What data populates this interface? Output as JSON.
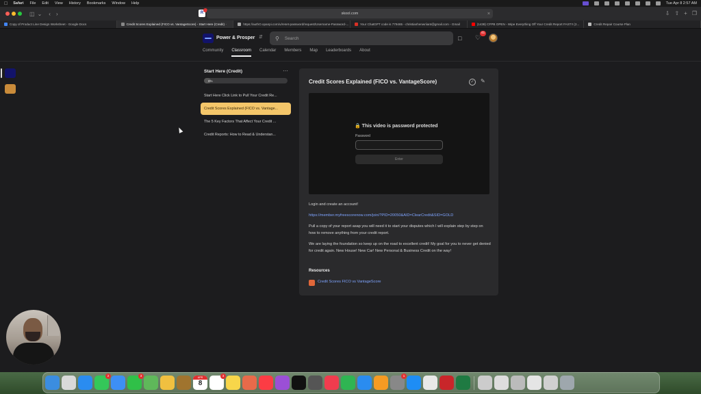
{
  "menubar": {
    "app": "Safari",
    "items": [
      "File",
      "Edit",
      "View",
      "History",
      "Bookmarks",
      "Window",
      "Help"
    ],
    "clock": "Tue Apr 8  2:57 AM"
  },
  "browser": {
    "url": "skool.com",
    "extension_badge": "R"
  },
  "tabs": [
    {
      "label": "Copy of Product Line Design Worksheet - Google Docs",
      "color": "#4285f4"
    },
    {
      "label": "Credit Scores Explained (FICO vs. VantageScore) - Start Here (Credit) ·",
      "color": "#888888",
      "active": true
    },
    {
      "label": "https://authO.opanpi.com/u/reset-password/request/Username-Password-...",
      "color": "#aaaaaa"
    },
    {
      "label": "Your ChatGPT code is 779465 - christianhenwriiant@gmail.com - Gmail",
      "color": "#d93025"
    },
    {
      "label": "(1438) CFPB OPEN - Wipe Everything Off Your Credit Report FAST!! (2...",
      "color": "#ff0000"
    },
    {
      "label": "Credit Repair Course Plan",
      "color": "#bbbbbb"
    }
  ],
  "header": {
    "brand": "Power & Prosper",
    "search_placeholder": "Search",
    "notifications": "41"
  },
  "nav": [
    "Community",
    "Classroom",
    "Calendar",
    "Members",
    "Map",
    "Leaderboards",
    "About"
  ],
  "course": {
    "title": "Start Here (Credit)",
    "progress_label": "8%",
    "progress": 0.08,
    "lessons": [
      "Start Here Click Link to Pull Your Credit Re...",
      "Credit Scores Explained (FICO vs. Vantage...",
      "The 5 Key Factors That Affect Your Credit ...",
      "Credit Reports: How to Read & Understan..."
    ]
  },
  "lesson": {
    "title": "Credit Scores Explained (FICO vs. VantageScore)",
    "video_message": "This video is password protected",
    "password_label": "Password",
    "enter_label": "Enter",
    "p1": "Login and create an account!",
    "link": "https://member.myfreescorenow.com/join/?PID=20050&AID=ClearCredit&SID=GOLD",
    "p2": "Pull a copy of your report asap you will need it to start your disputes which I will explain step by step on how to remove anything from your credit report.",
    "p3": "We are laying the foundation so keep up on the road to excellent credit! My goal for you to never get denied for credit again. New House! New Car! New Personal & Business Credit on the way!",
    "resources_heading": "Resources",
    "resource_link": "Credit Scores FICO vs VantageScore"
  },
  "dock": [
    {
      "name": "finder-icon",
      "color": "#3b8de0"
    },
    {
      "name": "launchpad-icon",
      "color": "#d9d9d9"
    },
    {
      "name": "safari-icon",
      "color": "#2a8cf0"
    },
    {
      "name": "messages-icon",
      "color": "#34c759",
      "badge": "2"
    },
    {
      "name": "mail-icon",
      "color": "#3d8ff5"
    },
    {
      "name": "facetime-icon",
      "color": "#30c048",
      "badge": "3"
    },
    {
      "name": "maps-icon",
      "color": "#5fb85a"
    },
    {
      "name": "photos-icon",
      "color": "#f0c040"
    },
    {
      "name": "notes-brown-icon",
      "color": "#a0742e"
    },
    {
      "name": "calendar-icon",
      "color": "#ffffff",
      "month": "APR",
      "day": "8"
    },
    {
      "name": "reminders-icon",
      "color": "#ffffff",
      "badge": "3"
    },
    {
      "name": "notes-icon",
      "color": "#f7d64a"
    },
    {
      "name": "photos-flower-icon",
      "color": "#e86a4a"
    },
    {
      "name": "music-icon",
      "color": "#fc3c44"
    },
    {
      "name": "podcasts-icon",
      "color": "#9b4fd6"
    },
    {
      "name": "tv-icon",
      "color": "#111111"
    },
    {
      "name": "calculator-icon",
      "color": "#555555"
    },
    {
      "name": "news-icon",
      "color": "#f03c4e"
    },
    {
      "name": "numbers-icon",
      "color": "#2fb552"
    },
    {
      "name": "keynote-icon",
      "color": "#2a8cf0"
    },
    {
      "name": "pages-icon",
      "color": "#f59b23"
    },
    {
      "name": "system-settings-icon",
      "color": "#888888",
      "badge": "1"
    },
    {
      "name": "app-store-icon",
      "color": "#1e8df5"
    },
    {
      "name": "chrome-icon",
      "color": "#e8e8e8"
    },
    {
      "name": "pdf-icon",
      "color": "#c8262a"
    },
    {
      "name": "excel-icon",
      "color": "#1f7a42"
    },
    {
      "name": "recent-window-1-icon",
      "color": "#cccccc"
    },
    {
      "name": "recent-window-2-icon",
      "color": "#dddddd"
    },
    {
      "name": "recent-window-3-icon",
      "color": "#bbbbbb"
    },
    {
      "name": "recent-window-4-icon",
      "color": "#e5e5e5"
    },
    {
      "name": "recent-window-5-icon",
      "color": "#d0d0d0"
    },
    {
      "name": "trash-icon",
      "color": "#9ea7ad"
    }
  ]
}
